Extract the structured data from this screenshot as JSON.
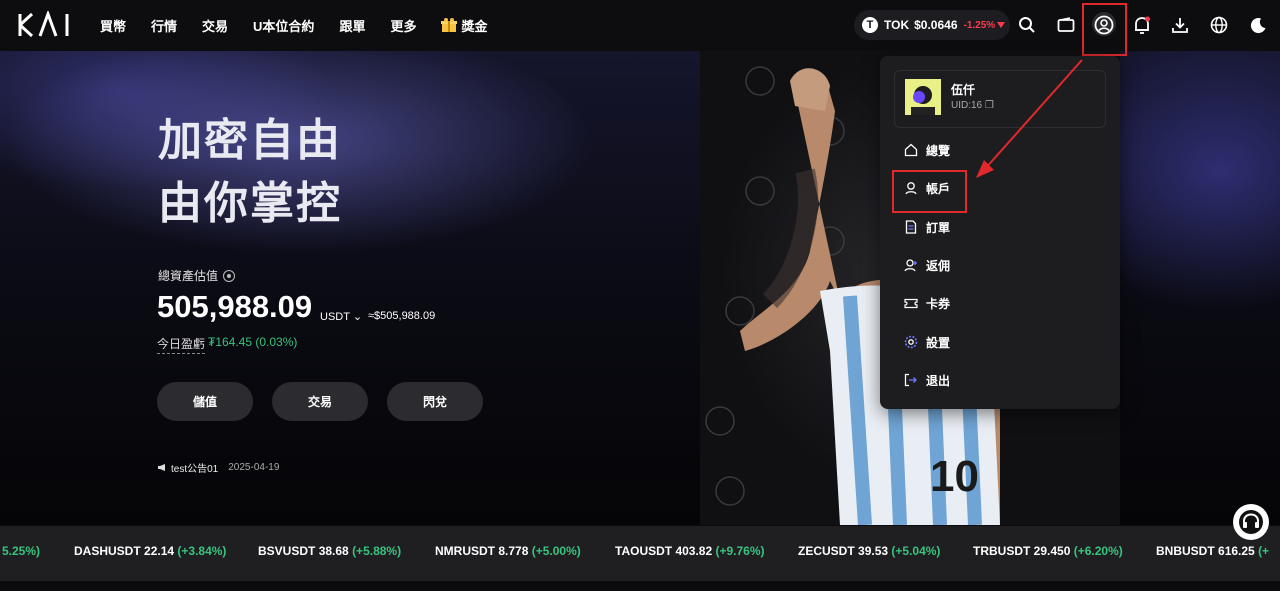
{
  "nav": {
    "logo": "KAI",
    "items": [
      "買幣",
      "行情",
      "交易",
      "U本位合約",
      "跟單",
      "更多"
    ],
    "rewards": "獎金"
  },
  "ticker_pill": {
    "symbol": "TOK",
    "price": "$0.0646",
    "change": "-1.25%"
  },
  "hero": {
    "line1": "加密自由",
    "line2": "由你掌控",
    "asset_label": "總資產估值",
    "asset_value": "505,988.09",
    "asset_unit": "USDT",
    "asset_usd": "≈$505,988.09",
    "pnl_label": "今日盈虧",
    "pnl_value": "₮164.45 (0.03%)",
    "buttons": [
      "儲值",
      "交易",
      "閃兌"
    ],
    "announcement": "test公告01",
    "announcement_date": "2025-04-19"
  },
  "dropdown": {
    "name": "伍仟",
    "uid": "UID:16",
    "items": [
      "總覽",
      "帳戶",
      "訂單",
      "返佣",
      "卡券",
      "設置",
      "退出"
    ]
  },
  "ticker": [
    {
      "sym": "",
      "price": "",
      "chg": "5.25%)"
    },
    {
      "sym": "DASHUSDT",
      "price": "22.14",
      "chg": "(+3.84%)"
    },
    {
      "sym": "BSVUSDT",
      "price": "38.68",
      "chg": "(+5.88%)"
    },
    {
      "sym": "NMRUSDT",
      "price": "8.778",
      "chg": "(+5.00%)"
    },
    {
      "sym": "TAOUSDT",
      "price": "403.82",
      "chg": "(+9.76%)"
    },
    {
      "sym": "ZECUSDT",
      "price": "39.53",
      "chg": "(+5.04%)"
    },
    {
      "sym": "TRBUSDT",
      "price": "29.450",
      "chg": "(+6.20%)"
    },
    {
      "sym": "BNBUSDT",
      "price": "616.25",
      "chg": "(+"
    }
  ],
  "colors": {
    "accent_red": "#e1292c",
    "up_green": "#37c47f",
    "down_red": "#ff3b4e"
  }
}
